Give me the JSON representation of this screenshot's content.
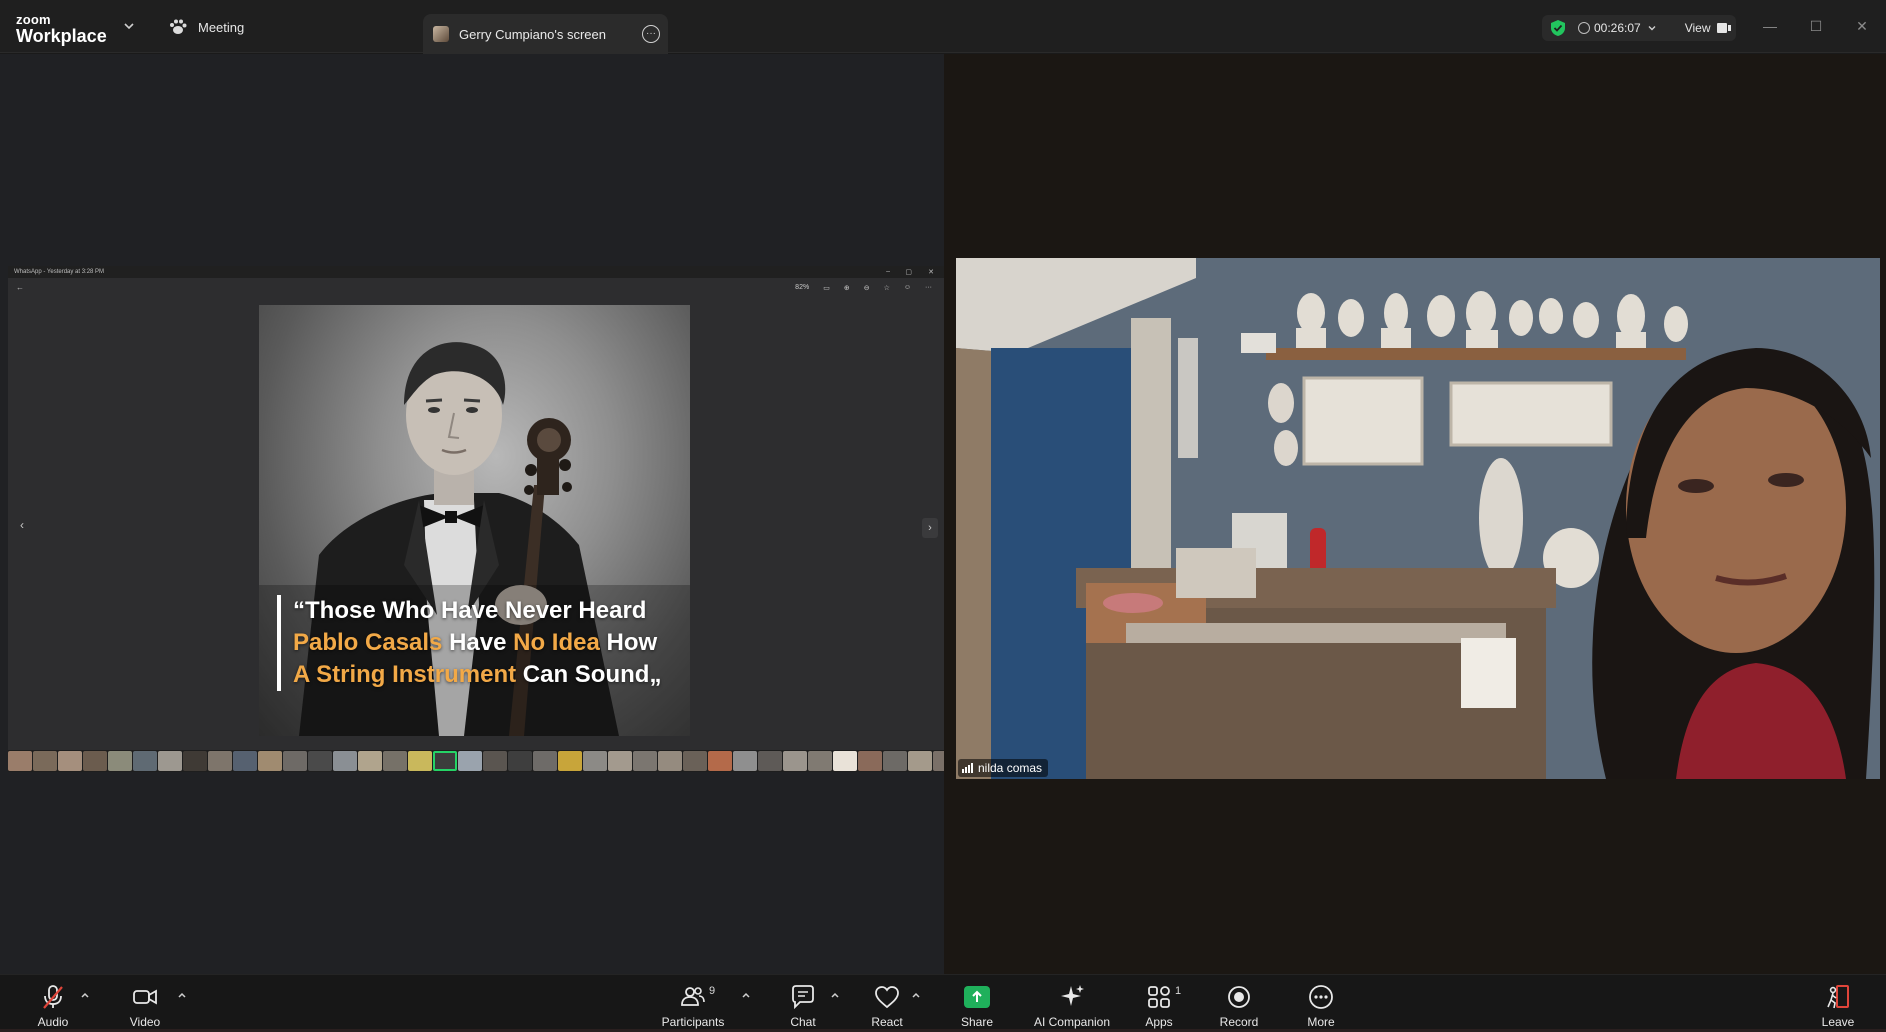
{
  "titlebar": {
    "logo_line1": "zoom",
    "logo_line2": "Workplace",
    "meeting_tab": "Meeting",
    "screen_tab": "Gerry Cumpiano's screen",
    "timer": "00:26:07",
    "view_label": "View",
    "security_color": "#22c55e"
  },
  "shared_screen": {
    "window_title": "WhatsApp - Yesterday at 3:28 PM",
    "zoom_level": "82%",
    "quote": {
      "p1": "“Those Who Have Never Heard ",
      "h1": "Pablo Casals",
      "p2": " Have ",
      "h2": "No Idea",
      "p3": " How ",
      "h3": "A String Instrument",
      "p4": " Can Sound„"
    },
    "highlight_color": "#f2a947"
  },
  "video": {
    "participant_name": "nilda comas"
  },
  "toolbar": {
    "audio": "Audio",
    "video": "Video",
    "participants": "Participants",
    "participants_count": "9",
    "chat": "Chat",
    "react": "React",
    "share": "Share",
    "ai_companion": "AI Companion",
    "apps": "Apps",
    "apps_count": "1",
    "record": "Record",
    "more": "More",
    "leave": "Leave",
    "share_color": "#1fb05b",
    "leave_color": "#e0453a"
  }
}
